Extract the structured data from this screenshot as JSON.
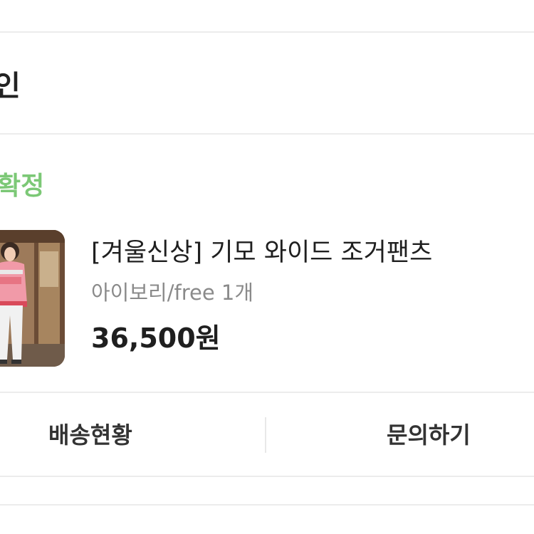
{
  "header": {
    "title": "인"
  },
  "order": {
    "status": "확정"
  },
  "product": {
    "name": "[겨울신상] 기모 와이드 조거팬츠",
    "option": "아이보리/free 1개",
    "price": "36,500원",
    "thumbnail_icon": "product-photo"
  },
  "actions": {
    "shipping_status": "배송현황",
    "inquiry": "문의하기"
  },
  "colors": {
    "status_green": "#7cc876",
    "text_primary": "#1f1f1f",
    "text_secondary": "#8a8a8a",
    "divider": "#ececec"
  }
}
